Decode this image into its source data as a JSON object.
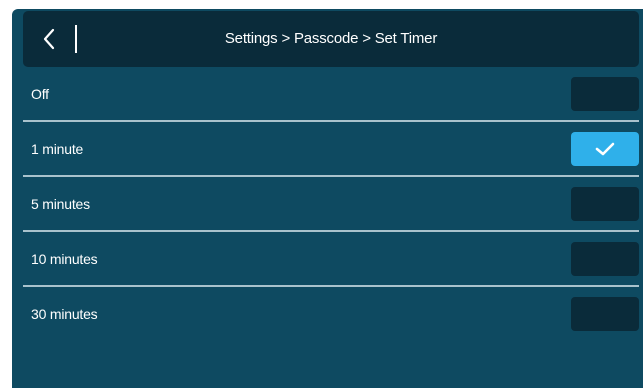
{
  "header": {
    "title": "Settings > Passcode > Set Timer",
    "back_icon": "chevron-left-icon"
  },
  "options": [
    {
      "label": "Off",
      "selected": false
    },
    {
      "label": "1 minute",
      "selected": true
    },
    {
      "label": "5 minutes",
      "selected": false
    },
    {
      "label": "10 minutes",
      "selected": false
    },
    {
      "label": "30 minutes",
      "selected": false
    }
  ],
  "colors": {
    "screen_background": "#0e4a61",
    "header_background": "#0a2b3a",
    "unchecked_box": "#0a2b3a",
    "checked_box": "#2fb0ea",
    "divider": "#a9c2cc",
    "text": "#ffffff"
  }
}
